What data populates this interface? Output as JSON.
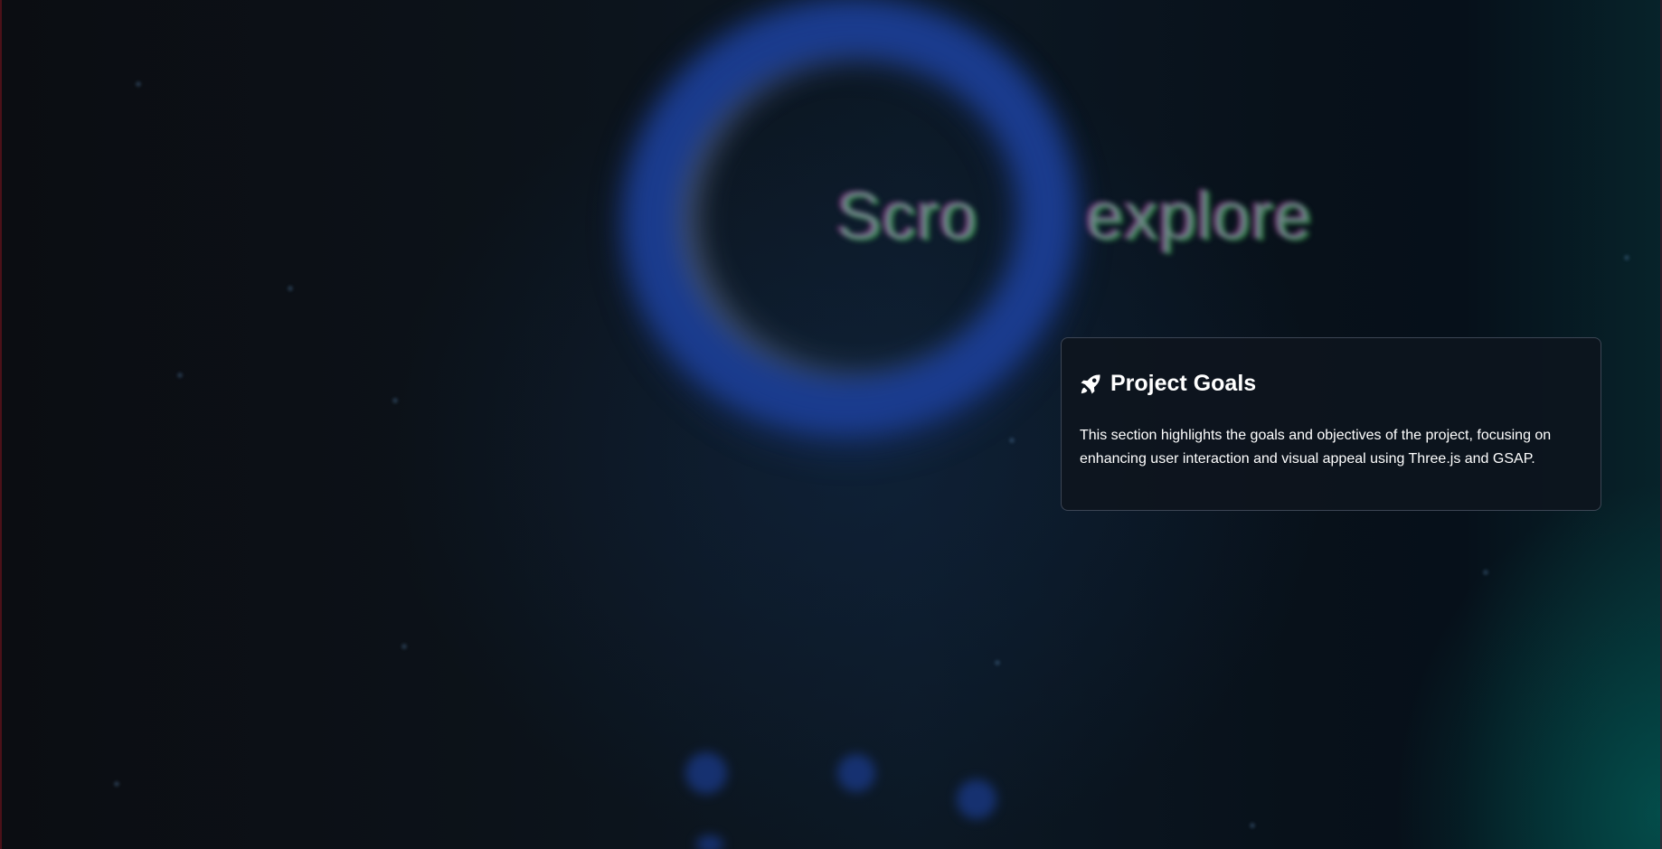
{
  "background": {
    "hero_word_1": "Scro",
    "hero_word_2": "explore",
    "accent_color": "#1b3d92",
    "teal_glow_color": "#07464a"
  },
  "card": {
    "icon": "rocket-icon",
    "title": "Project Goals",
    "description": "This section highlights the goals and objectives of the project, focusing on enhancing user interaction and visual appeal using Three.js and GSAP."
  }
}
